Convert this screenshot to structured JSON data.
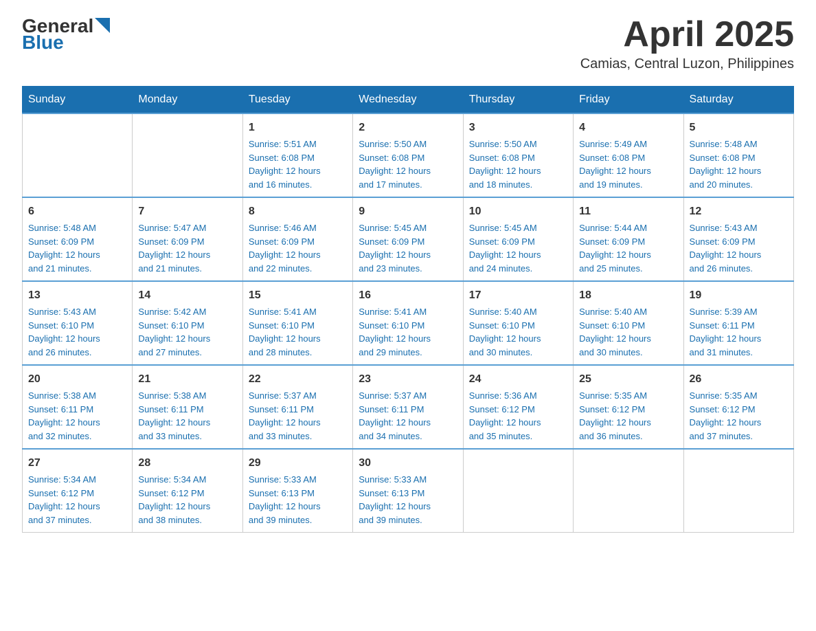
{
  "header": {
    "logo_text_general": "General",
    "logo_text_blue": "Blue",
    "month_title": "April 2025",
    "location": "Camias, Central Luzon, Philippines"
  },
  "days_of_week": [
    "Sunday",
    "Monday",
    "Tuesday",
    "Wednesday",
    "Thursday",
    "Friday",
    "Saturday"
  ],
  "weeks": [
    [
      {
        "day": "",
        "info": ""
      },
      {
        "day": "",
        "info": ""
      },
      {
        "day": "1",
        "info": "Sunrise: 5:51 AM\nSunset: 6:08 PM\nDaylight: 12 hours\nand 16 minutes."
      },
      {
        "day": "2",
        "info": "Sunrise: 5:50 AM\nSunset: 6:08 PM\nDaylight: 12 hours\nand 17 minutes."
      },
      {
        "day": "3",
        "info": "Sunrise: 5:50 AM\nSunset: 6:08 PM\nDaylight: 12 hours\nand 18 minutes."
      },
      {
        "day": "4",
        "info": "Sunrise: 5:49 AM\nSunset: 6:08 PM\nDaylight: 12 hours\nand 19 minutes."
      },
      {
        "day": "5",
        "info": "Sunrise: 5:48 AM\nSunset: 6:08 PM\nDaylight: 12 hours\nand 20 minutes."
      }
    ],
    [
      {
        "day": "6",
        "info": "Sunrise: 5:48 AM\nSunset: 6:09 PM\nDaylight: 12 hours\nand 21 minutes."
      },
      {
        "day": "7",
        "info": "Sunrise: 5:47 AM\nSunset: 6:09 PM\nDaylight: 12 hours\nand 21 minutes."
      },
      {
        "day": "8",
        "info": "Sunrise: 5:46 AM\nSunset: 6:09 PM\nDaylight: 12 hours\nand 22 minutes."
      },
      {
        "day": "9",
        "info": "Sunrise: 5:45 AM\nSunset: 6:09 PM\nDaylight: 12 hours\nand 23 minutes."
      },
      {
        "day": "10",
        "info": "Sunrise: 5:45 AM\nSunset: 6:09 PM\nDaylight: 12 hours\nand 24 minutes."
      },
      {
        "day": "11",
        "info": "Sunrise: 5:44 AM\nSunset: 6:09 PM\nDaylight: 12 hours\nand 25 minutes."
      },
      {
        "day": "12",
        "info": "Sunrise: 5:43 AM\nSunset: 6:09 PM\nDaylight: 12 hours\nand 26 minutes."
      }
    ],
    [
      {
        "day": "13",
        "info": "Sunrise: 5:43 AM\nSunset: 6:10 PM\nDaylight: 12 hours\nand 26 minutes."
      },
      {
        "day": "14",
        "info": "Sunrise: 5:42 AM\nSunset: 6:10 PM\nDaylight: 12 hours\nand 27 minutes."
      },
      {
        "day": "15",
        "info": "Sunrise: 5:41 AM\nSunset: 6:10 PM\nDaylight: 12 hours\nand 28 minutes."
      },
      {
        "day": "16",
        "info": "Sunrise: 5:41 AM\nSunset: 6:10 PM\nDaylight: 12 hours\nand 29 minutes."
      },
      {
        "day": "17",
        "info": "Sunrise: 5:40 AM\nSunset: 6:10 PM\nDaylight: 12 hours\nand 30 minutes."
      },
      {
        "day": "18",
        "info": "Sunrise: 5:40 AM\nSunset: 6:10 PM\nDaylight: 12 hours\nand 30 minutes."
      },
      {
        "day": "19",
        "info": "Sunrise: 5:39 AM\nSunset: 6:11 PM\nDaylight: 12 hours\nand 31 minutes."
      }
    ],
    [
      {
        "day": "20",
        "info": "Sunrise: 5:38 AM\nSunset: 6:11 PM\nDaylight: 12 hours\nand 32 minutes."
      },
      {
        "day": "21",
        "info": "Sunrise: 5:38 AM\nSunset: 6:11 PM\nDaylight: 12 hours\nand 33 minutes."
      },
      {
        "day": "22",
        "info": "Sunrise: 5:37 AM\nSunset: 6:11 PM\nDaylight: 12 hours\nand 33 minutes."
      },
      {
        "day": "23",
        "info": "Sunrise: 5:37 AM\nSunset: 6:11 PM\nDaylight: 12 hours\nand 34 minutes."
      },
      {
        "day": "24",
        "info": "Sunrise: 5:36 AM\nSunset: 6:12 PM\nDaylight: 12 hours\nand 35 minutes."
      },
      {
        "day": "25",
        "info": "Sunrise: 5:35 AM\nSunset: 6:12 PM\nDaylight: 12 hours\nand 36 minutes."
      },
      {
        "day": "26",
        "info": "Sunrise: 5:35 AM\nSunset: 6:12 PM\nDaylight: 12 hours\nand 37 minutes."
      }
    ],
    [
      {
        "day": "27",
        "info": "Sunrise: 5:34 AM\nSunset: 6:12 PM\nDaylight: 12 hours\nand 37 minutes."
      },
      {
        "day": "28",
        "info": "Sunrise: 5:34 AM\nSunset: 6:12 PM\nDaylight: 12 hours\nand 38 minutes."
      },
      {
        "day": "29",
        "info": "Sunrise: 5:33 AM\nSunset: 6:13 PM\nDaylight: 12 hours\nand 39 minutes."
      },
      {
        "day": "30",
        "info": "Sunrise: 5:33 AM\nSunset: 6:13 PM\nDaylight: 12 hours\nand 39 minutes."
      },
      {
        "day": "",
        "info": ""
      },
      {
        "day": "",
        "info": ""
      },
      {
        "day": "",
        "info": ""
      }
    ]
  ]
}
